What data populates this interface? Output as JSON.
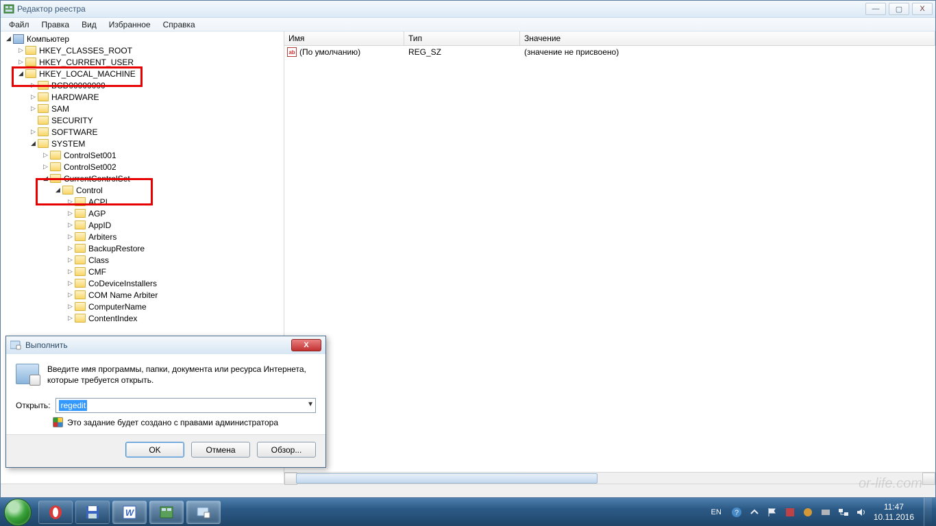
{
  "window": {
    "title": "Редактор реестра",
    "min": "—",
    "max": "▢",
    "close": "X"
  },
  "menubar": [
    "Файл",
    "Правка",
    "Вид",
    "Избранное",
    "Справка"
  ],
  "tree": [
    {
      "depth": 0,
      "caret": "open",
      "icon": "comp",
      "label": "Компьютер"
    },
    {
      "depth": 1,
      "caret": "expand",
      "icon": "folder",
      "label": "HKEY_CLASSES_ROOT"
    },
    {
      "depth": 1,
      "caret": "expand",
      "icon": "folder",
      "label": "HKEY_CURRENT_USER"
    },
    {
      "depth": 1,
      "caret": "open",
      "icon": "folder",
      "label": "HKEY_LOCAL_MACHINE"
    },
    {
      "depth": 2,
      "caret": "expand",
      "icon": "folder",
      "label": "BCD00000000"
    },
    {
      "depth": 2,
      "caret": "expand",
      "icon": "folder",
      "label": "HARDWARE"
    },
    {
      "depth": 2,
      "caret": "expand",
      "icon": "folder",
      "label": "SAM"
    },
    {
      "depth": 2,
      "caret": "none",
      "icon": "folder",
      "label": "SECURITY"
    },
    {
      "depth": 2,
      "caret": "expand",
      "icon": "folder",
      "label": "SOFTWARE"
    },
    {
      "depth": 2,
      "caret": "open",
      "icon": "folder",
      "label": "SYSTEM"
    },
    {
      "depth": 3,
      "caret": "expand",
      "icon": "folder",
      "label": "ControlSet001"
    },
    {
      "depth": 3,
      "caret": "expand",
      "icon": "folder",
      "label": "ControlSet002"
    },
    {
      "depth": 3,
      "caret": "open",
      "icon": "folder",
      "label": "CurrentControlSet"
    },
    {
      "depth": 4,
      "caret": "open",
      "icon": "folder",
      "label": "Control"
    },
    {
      "depth": 5,
      "caret": "expand",
      "icon": "folder",
      "label": "ACPI"
    },
    {
      "depth": 5,
      "caret": "expand",
      "icon": "folder",
      "label": "AGP"
    },
    {
      "depth": 5,
      "caret": "expand",
      "icon": "folder",
      "label": "AppID"
    },
    {
      "depth": 5,
      "caret": "expand",
      "icon": "folder",
      "label": "Arbiters"
    },
    {
      "depth": 5,
      "caret": "expand",
      "icon": "folder",
      "label": "BackupRestore"
    },
    {
      "depth": 5,
      "caret": "expand",
      "icon": "folder",
      "label": "Class"
    },
    {
      "depth": 5,
      "caret": "expand",
      "icon": "folder",
      "label": "CMF"
    },
    {
      "depth": 5,
      "caret": "expand",
      "icon": "folder",
      "label": "CoDeviceInstallers"
    },
    {
      "depth": 5,
      "caret": "expand",
      "icon": "folder",
      "label": "COM Name Arbiter"
    },
    {
      "depth": 5,
      "caret": "expand",
      "icon": "folder",
      "label": "ComputerName"
    },
    {
      "depth": 5,
      "caret": "expand",
      "icon": "folder",
      "label": "ContentIndex"
    }
  ],
  "list": {
    "columns": {
      "name": "Имя",
      "type": "Тип",
      "value": "Значение"
    },
    "rows": [
      {
        "name": "(По умолчанию)",
        "type": "REG_SZ",
        "value": "(значение не присвоено)"
      }
    ],
    "icon_text": "ab"
  },
  "run": {
    "title": "Выполнить",
    "desc": "Введите имя программы, папки, документа или ресурса Интернета, которые требуется открыть.",
    "open_label": "Открыть:",
    "value": "regedit",
    "admin_note": "Это задание будет создано с правами администратора",
    "ok": "OK",
    "cancel": "Отмена",
    "browse": "Обзор...",
    "close": "X"
  },
  "tray": {
    "lang": "EN",
    "time": "11:47",
    "date": "10.11.2016"
  },
  "watermark": "or-life.com"
}
